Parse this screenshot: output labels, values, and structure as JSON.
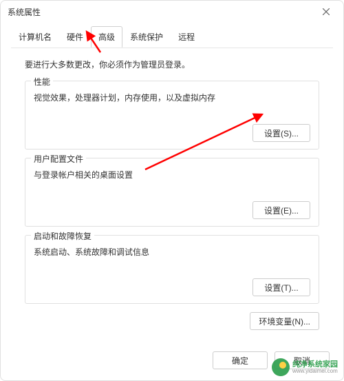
{
  "window": {
    "title": "系统属性"
  },
  "tabs": {
    "computer_name": "计算机名",
    "hardware": "硬件",
    "advanced": "高级",
    "system_protection": "系统保护",
    "remote": "远程"
  },
  "content": {
    "intro": "要进行大多数更改，你必须作为管理员登录。",
    "performance": {
      "title": "性能",
      "desc": "视觉效果，处理器计划，内存使用，以及虚拟内存",
      "button": "设置(S)..."
    },
    "user_profile": {
      "title": "用户配置文件",
      "desc": "与登录帐户相关的桌面设置",
      "button": "设置(E)..."
    },
    "startup": {
      "title": "启动和故障恢复",
      "desc": "系统启动、系统故障和调试信息",
      "button": "设置(T)..."
    },
    "env_button": "环境变量(N)..."
  },
  "footer": {
    "ok": "确定",
    "cancel": "取消"
  },
  "watermark": {
    "main": "纯净系统家园",
    "sub": "www.yidaimei.com"
  },
  "colors": {
    "arrow": "#ff0000",
    "border": "#e0e0e0",
    "text": "#333333"
  }
}
